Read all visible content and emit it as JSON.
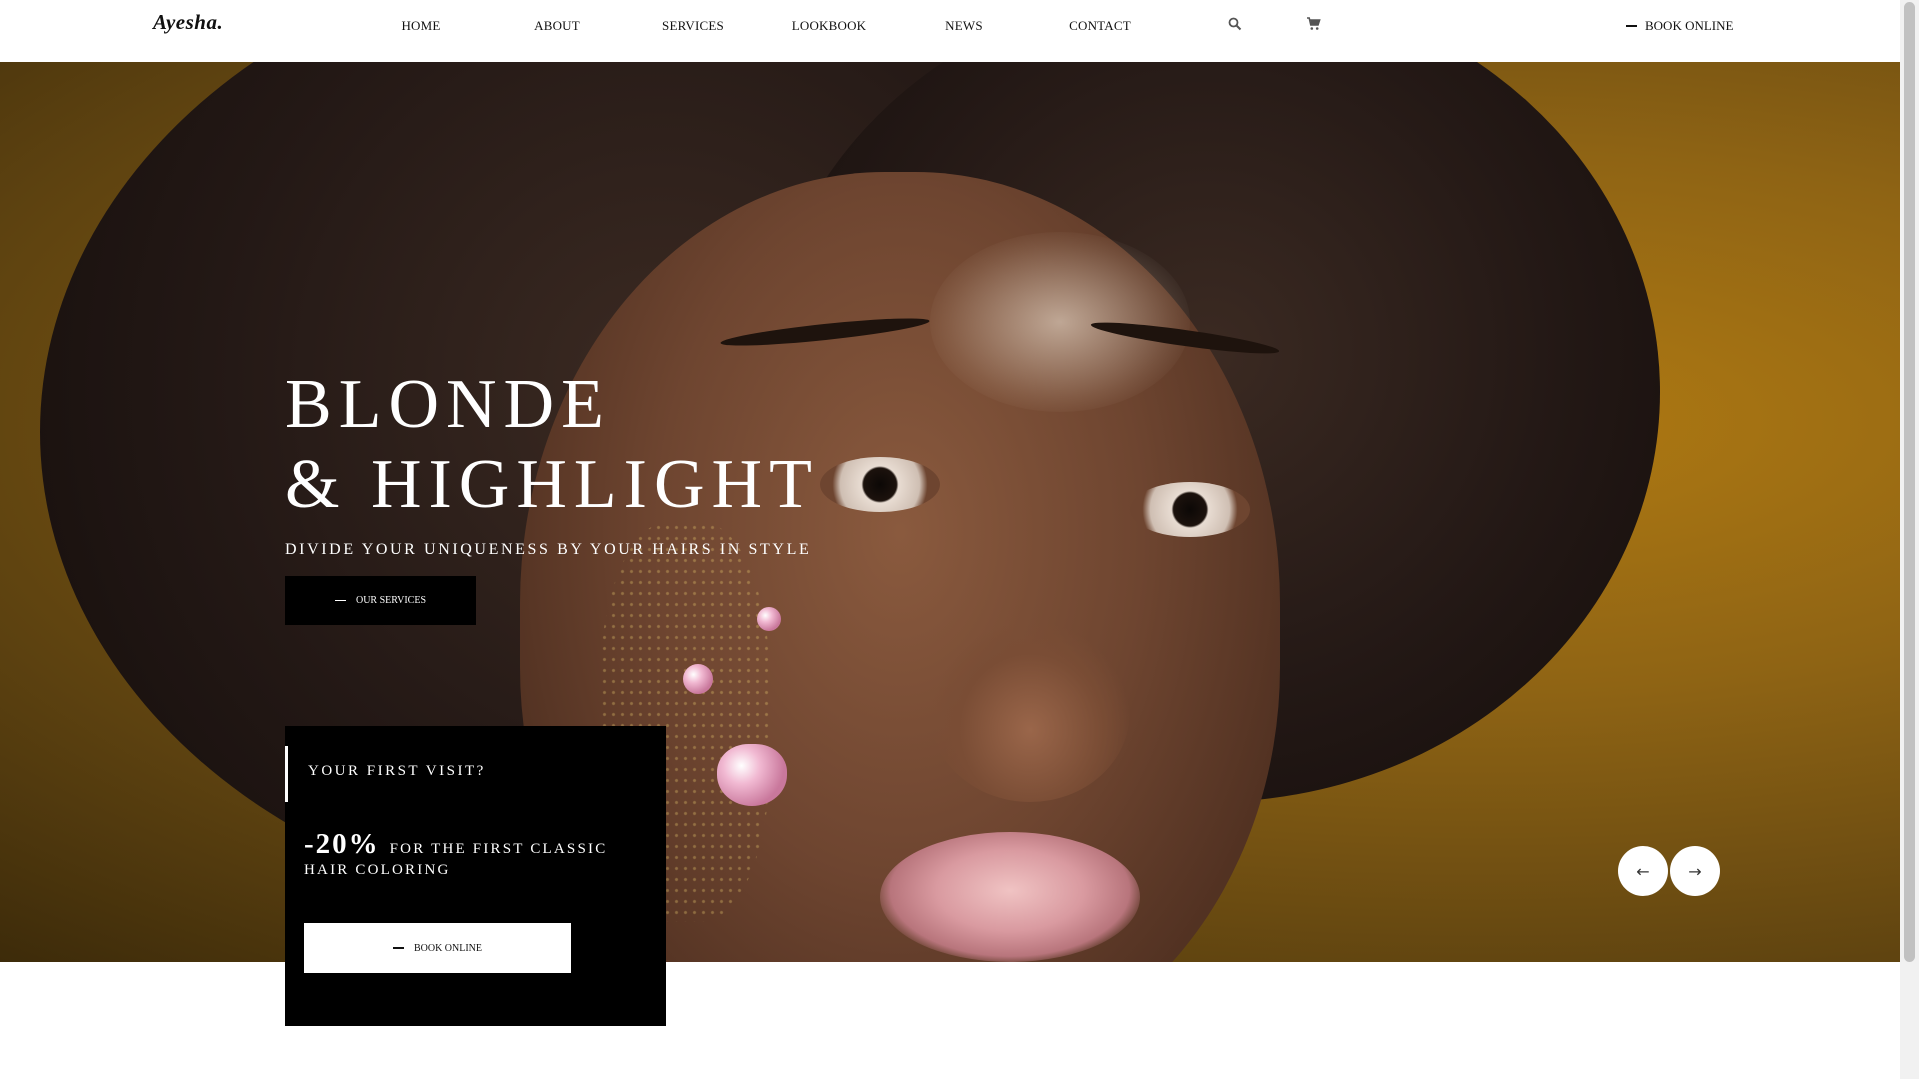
{
  "header": {
    "logo": "Ayesha.",
    "nav": [
      {
        "label": "HOME"
      },
      {
        "label": "ABOUT"
      },
      {
        "label": "SERVICES"
      },
      {
        "label": "LOOKBOOK"
      },
      {
        "label": "NEWS"
      },
      {
        "label": "CONTACT"
      }
    ],
    "icons": [
      "search-icon",
      "cart-icon"
    ],
    "book_label": "BOOK ONLINE"
  },
  "hero": {
    "title_line1": "BLONDE",
    "title_line2": "& HIGHLIGHT",
    "subtitle": "DIVIDE YOUR UNIQUENESS BY YOUR HAIRS IN STYLE",
    "services_button": "OUR SERVICES",
    "prev_icon": "arrow-left-icon",
    "next_icon": "arrow-right-icon"
  },
  "promo": {
    "heading": "YOUR FIRST VISIT?",
    "percent": "-20%",
    "offer_text": "FOR THE FIRST CLASSIC HAIR COLORING",
    "book_button": "BOOK ONLINE"
  },
  "colors": {
    "accent": "#000000",
    "hero_background": "#8f6414",
    "text_light": "#ffffff"
  }
}
